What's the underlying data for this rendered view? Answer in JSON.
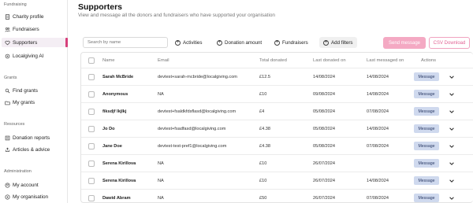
{
  "sidebar": {
    "sections": [
      {
        "label": "Fundraising"
      },
      {
        "label": "Grants"
      },
      {
        "label": "Resources"
      },
      {
        "label": "Administration"
      }
    ],
    "items": [
      {
        "label": "Charity profile",
        "icon": "document-icon"
      },
      {
        "label": "Fundraisers",
        "icon": "people-icon"
      },
      {
        "label": "Supporters",
        "icon": "heart-icon",
        "active": true
      },
      {
        "label": "Localgiving AI",
        "icon": "sparkle-icon"
      },
      {
        "label": "Find grants",
        "icon": "search-icon"
      },
      {
        "label": "My grants",
        "icon": "folder-icon"
      },
      {
        "label": "Donation reports",
        "icon": "report-icon"
      },
      {
        "label": "Articles & advice",
        "icon": "link-icon"
      },
      {
        "label": "My account",
        "icon": "user-icon"
      },
      {
        "label": "My organisation",
        "icon": "building-icon"
      }
    ]
  },
  "header": {
    "title": "Supporters",
    "subtitle": "View and message all the donors and fundraisers who have supported your organisation"
  },
  "toolbar": {
    "search_placeholder": "Search by name",
    "filters": [
      "Activities",
      "Donation amount",
      "Fundraisers"
    ],
    "add_filters": "Add filters",
    "send_message": "Send message",
    "csv_download": "CSV Download"
  },
  "table": {
    "columns": [
      "Name",
      "Email",
      "Total donated",
      "Last donated on",
      "Last messaged on",
      "Actions"
    ],
    "rows": [
      {
        "name": "Sarah McBride",
        "email": "devtest+sarah-mcbride@localgiving.com",
        "total": "£12.5",
        "last_donated": "14/08/2024",
        "last_messaged": "14/08/2024"
      },
      {
        "name": "Anonymous",
        "email": "NA",
        "total": "£10",
        "last_donated": "09/08/2024",
        "last_messaged": "14/08/2024"
      },
      {
        "name": "fiksdjf lkjlkj",
        "email": "devtest+fsaldkfdsflasd@localgiving.com",
        "total": "£4",
        "last_donated": "05/08/2024",
        "last_messaged": "07/08/2024"
      },
      {
        "name": "Jo Do",
        "email": "devtest+fsadfasd@localgiving.com",
        "total": "£4.38",
        "last_donated": "05/08/2024",
        "last_messaged": "14/08/2024"
      },
      {
        "name": "Jane Doe",
        "email": "devtest-test-pref1@localgiving.com",
        "total": "£4.38",
        "last_donated": "05/08/2024",
        "last_messaged": "07/08/2024"
      },
      {
        "name": "Serena Kirillova",
        "email": "NA",
        "total": "£10",
        "last_donated": "26/07/2024",
        "last_messaged": ""
      },
      {
        "name": "Serena Kirillova",
        "email": "NA",
        "total": "£10",
        "last_donated": "26/07/2024",
        "last_messaged": "14/08/2024"
      },
      {
        "name": "Dawid Abram",
        "email": "NA",
        "total": "£50",
        "last_donated": "26/07/2024",
        "last_messaged": "07/08/2024"
      }
    ],
    "action_label": "Message"
  },
  "colors": {
    "accent": "#d6407b",
    "send_button": "#f4a9c3",
    "message_button": "#cfd9ee"
  }
}
